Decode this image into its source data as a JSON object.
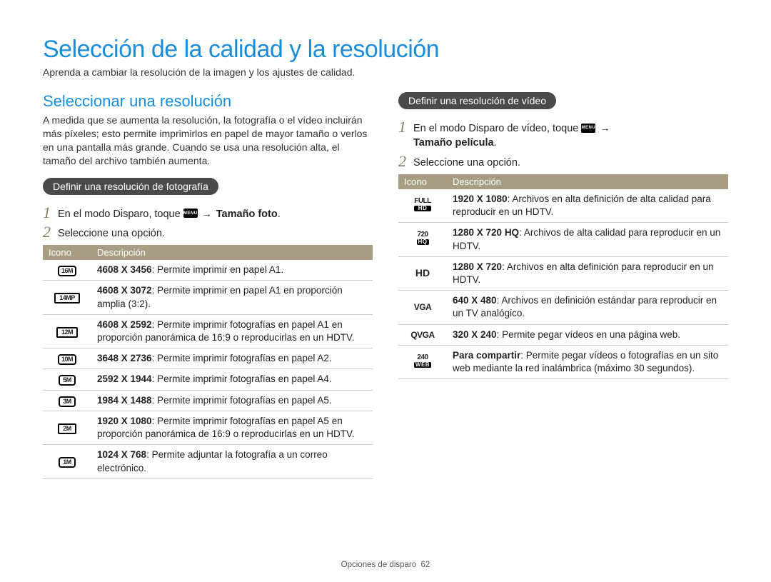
{
  "page_title": "Selección de la calidad y la resolución",
  "intro": "Aprenda a cambiar la resolución de la imagen y los ajustes de calidad.",
  "left": {
    "section_title": "Seleccionar una resolución",
    "section_intro": "A medida que se aumenta la resolución, la fotografía o el vídeo incluirán más píxeles; esto permite imprimirlos en papel de mayor tamaño o verlos en una pantalla más grande. Cuando se usa una resolución alta, el tamaño del archivo también aumenta.",
    "pill": "Definir una resolución de fotografía",
    "step1_prefix": "En el modo Disparo, toque ",
    "step1_arrow": "→",
    "step1_bold": "Tamaño foto",
    "step1_period": ".",
    "step2": "Seleccione una opción.",
    "table": {
      "head_icon": "Icono",
      "head_desc": "Descripción",
      "rows": [
        {
          "icon_label": "16M",
          "bold": "4608 X 3456",
          "rest": ": Permite imprimir en papel A1."
        },
        {
          "icon_label": "14MP",
          "bold": "4608 X 3072",
          "rest": ": Permite imprimir en papel A1 en proporción amplia (3:2)."
        },
        {
          "icon_label": "12M",
          "bold": "4608 X 2592",
          "rest": ": Permite imprimir fotografías en papel A1 en proporción panorámica de 16:9 o reproducirlas en un HDTV."
        },
        {
          "icon_label": "10M",
          "bold": "3648 X 2736",
          "rest": ": Permite imprimir fotografías en papel A2."
        },
        {
          "icon_label": "5M",
          "bold": "2592 X 1944",
          "rest": ": Permite imprimir fotografías en papel A4."
        },
        {
          "icon_label": "3M",
          "bold": "1984 X 1488",
          "rest": ": Permite imprimir fotografías en papel A5."
        },
        {
          "icon_label": "2M",
          "bold": "1920 X 1080",
          "rest": ": Permite imprimir fotografías en papel A5 en proporción panorámica de 16:9 o reproducirlas en un HDTV."
        },
        {
          "icon_label": "1M",
          "bold": "1024 X 768",
          "rest": ": Permite adjuntar la fotografía a un correo electrónico."
        }
      ]
    }
  },
  "right": {
    "pill": "Definir una resolución de vídeo",
    "step1_prefix": "En el modo Disparo de vídeo, toque ",
    "step1_arrow": "→",
    "step1_bold": "Tamaño película",
    "step1_period": ".",
    "step2": "Seleccione una opción.",
    "table": {
      "head_icon": "Icono",
      "head_desc": "Descripción",
      "rows": [
        {
          "icon_top": "FULL",
          "icon_bot": "HD",
          "bold": "1920 X 1080",
          "rest": ": Archivos en alta definición de alta calidad para reproducir en un HDTV."
        },
        {
          "icon_top": "720",
          "icon_bot": "HQ",
          "bold": "1280 X 720 HQ",
          "rest": ": Archivos de alta calidad para reproducir en un HDTV."
        },
        {
          "icon_plain": "HD",
          "bold": "1280 X 720",
          "rest": ": Archivos en alta definición para reproducir en un HDTV."
        },
        {
          "icon_plain": "VGA",
          "bold": "640 X 480",
          "rest": ": Archivos en definición estándar para reproducir en un TV analógico."
        },
        {
          "icon_plain": "QVGA",
          "bold": "320 X 240",
          "rest": ": Permite pegar vídeos en una página web."
        },
        {
          "icon_top": "240",
          "icon_bot": "WEB",
          "bold": "Para compartir",
          "rest": ": Permite pegar vídeos o fotografías en un sito web mediante la red inalámbrica (máximo 30 segundos)."
        }
      ]
    }
  },
  "footer_label": "Opciones de disparo",
  "footer_page": "62",
  "menu_icon_label": "MENU"
}
